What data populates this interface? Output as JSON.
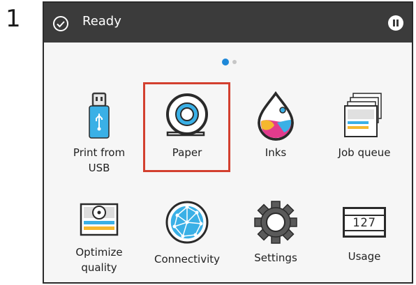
{
  "step_number": "1",
  "status": {
    "text": "Ready",
    "icon": "check-circle-icon"
  },
  "header": {
    "pause_icon": "pause-icon"
  },
  "pagination": {
    "current": 1,
    "total": 2
  },
  "tiles": [
    {
      "label": "Print from\nUSB",
      "icon": "usb-drive-icon",
      "selected": false
    },
    {
      "label": "Paper",
      "icon": "paper-roll-icon",
      "selected": true
    },
    {
      "label": "Inks",
      "icon": "ink-drop-icon",
      "selected": false
    },
    {
      "label": "Job queue",
      "icon": "job-queue-icon",
      "selected": false
    },
    {
      "label": "Optimize\nquality",
      "icon": "optimize-quality-icon",
      "selected": false
    },
    {
      "label": "Connectivity",
      "icon": "globe-network-icon",
      "selected": false
    },
    {
      "label": "Settings",
      "icon": "gear-icon",
      "selected": false
    },
    {
      "label": "Usage",
      "icon": "counter-icon",
      "selected": false,
      "counter_text": "127"
    }
  ],
  "colors": {
    "selection": "#d3402f",
    "accent": "#1e88d8",
    "header": "#3b3b3b"
  }
}
